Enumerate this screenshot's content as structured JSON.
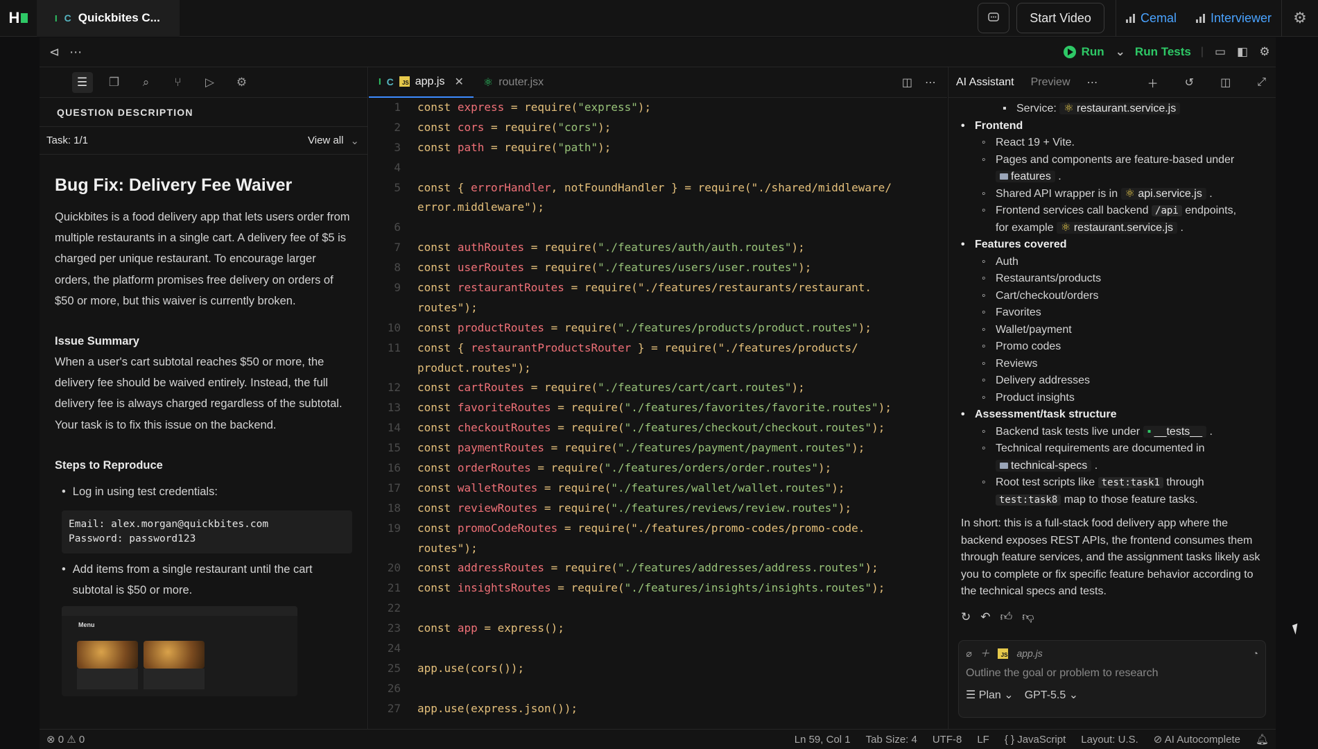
{
  "topbar": {
    "logo": "H",
    "app_tab_title": "Quickbites C...",
    "app_tab_icons": [
      "I",
      "C"
    ],
    "start_video": "Start Video",
    "participants": [
      "Cemal",
      "Interviewer"
    ]
  },
  "toolbar": {
    "run": "Run",
    "run_tests": "Run Tests"
  },
  "left": {
    "section_title": "QUESTION DESCRIPTION",
    "task_label": "Task: 1/1",
    "view_all": "View all",
    "title": "Bug Fix: Delivery Fee Waiver",
    "intro": "Quickbites is a food delivery app that lets users order from multiple restaurants in a single cart. A delivery fee of $5 is charged per unique restaurant. To encourage larger orders, the platform promises free delivery on orders of $50 or more, but this waiver is currently broken.",
    "issue_heading": "Issue Summary",
    "issue_text": "When a user's cart subtotal reaches $50 or more, the delivery fee should be waived entirely. Instead, the full delivery fee is always charged regardless of the subtotal. Your task is to fix this issue on the backend.",
    "steps_heading": "Steps to Reproduce",
    "step1": "Log in using test credentials:",
    "credentials": "Email: alex.morgan@quickbites.com\nPassword: password123",
    "step2": "Add items from a single restaurant until the cart subtotal is $50 or more.",
    "thumb_title": "Menu"
  },
  "editor": {
    "tabs": [
      {
        "label": "app.js",
        "active": true
      },
      {
        "label": "router.jsx",
        "active": false
      }
    ],
    "lines": [
      {
        "n": "1",
        "code": "const express = require(\"express\");"
      },
      {
        "n": "2",
        "code": "const cors = require(\"cors\");"
      },
      {
        "n": "3",
        "code": "const path = require(\"path\");"
      },
      {
        "n": "4",
        "code": ""
      },
      {
        "n": "5",
        "code": "const { errorHandler, notFoundHandler } = require(\"./shared/middleware/"
      },
      {
        "n": "",
        "code": "error.middleware\");"
      },
      {
        "n": "6",
        "code": ""
      },
      {
        "n": "7",
        "code": "const authRoutes = require(\"./features/auth/auth.routes\");"
      },
      {
        "n": "8",
        "code": "const userRoutes = require(\"./features/users/user.routes\");"
      },
      {
        "n": "9",
        "code": "const restaurantRoutes = require(\"./features/restaurants/restaurant."
      },
      {
        "n": "",
        "code": "routes\");"
      },
      {
        "n": "10",
        "code": "const productRoutes = require(\"./features/products/product.routes\");"
      },
      {
        "n": "11",
        "code": "const { restaurantProductsRouter } = require(\"./features/products/"
      },
      {
        "n": "",
        "code": "product.routes\");"
      },
      {
        "n": "12",
        "code": "const cartRoutes = require(\"./features/cart/cart.routes\");"
      },
      {
        "n": "13",
        "code": "const favoriteRoutes = require(\"./features/favorites/favorite.routes\");"
      },
      {
        "n": "14",
        "code": "const checkoutRoutes = require(\"./features/checkout/checkout.routes\");"
      },
      {
        "n": "15",
        "code": "const paymentRoutes = require(\"./features/payment/payment.routes\");"
      },
      {
        "n": "16",
        "code": "const orderRoutes = require(\"./features/orders/order.routes\");"
      },
      {
        "n": "17",
        "code": "const walletRoutes = require(\"./features/wallet/wallet.routes\");"
      },
      {
        "n": "18",
        "code": "const reviewRoutes = require(\"./features/reviews/review.routes\");"
      },
      {
        "n": "19",
        "code": "const promoCodeRoutes = require(\"./features/promo-codes/promo-code."
      },
      {
        "n": "",
        "code": "routes\");"
      },
      {
        "n": "20",
        "code": "const addressRoutes = require(\"./features/addresses/address.routes\");"
      },
      {
        "n": "21",
        "code": "const insightsRoutes = require(\"./features/insights/insights.routes\");"
      },
      {
        "n": "22",
        "code": ""
      },
      {
        "n": "23",
        "code": "const app = express();"
      },
      {
        "n": "24",
        "code": ""
      },
      {
        "n": "25",
        "code": "app.use(cors());"
      },
      {
        "n": "26",
        "code": ""
      },
      {
        "n": "27",
        "code": "app.use(express.json());"
      }
    ]
  },
  "assistant": {
    "tab_active": "AI Assistant",
    "tab_preview": "Preview",
    "service_label": "Service:",
    "service_file": "restaurant.service.js",
    "frontend": "Frontend",
    "fe_items": [
      "React 19 + Vite.",
      "Pages and components are feature-based under",
      "features",
      "Shared API wrapper is in",
      "api.service.js",
      "Frontend services call backend",
      "/api",
      "endpoints,",
      "for example",
      "restaurant.service.js"
    ],
    "features_covered": "Features covered",
    "features": [
      "Auth",
      "Restaurants/products",
      "Cart/checkout/orders",
      "Favorites",
      "Wallet/payment",
      "Promo codes",
      "Reviews",
      "Delivery addresses",
      "Product insights"
    ],
    "assessment": "Assessment/task structure",
    "as_items": {
      "a1": "Backend task tests live under",
      "a1_chip": "__tests__",
      "a2": "Technical requirements are documented in",
      "a2_chip": "technical-specs",
      "a3": "Root test scripts like",
      "a3_chip1": "test:task1",
      "a3_mid": "through",
      "a3_chip2": "test:task8",
      "a3_end": "map to those feature tasks."
    },
    "summary": "In short: this is a full-stack food delivery app where the backend exposes REST APIs, the frontend consumes them through feature services, and the assignment tasks likely ask you to complete or fix specific feature behavior according to the technical specs and tests.",
    "composer_file": "app.js",
    "composer_placeholder": "Outline the goal or problem to research",
    "mode": "Plan",
    "model": "GPT-5.5"
  },
  "status": {
    "errors": "0",
    "warnings": "0",
    "position": "Ln 59, Col 1",
    "tab_size": "Tab Size: 4",
    "encoding": "UTF-8",
    "eol": "LF",
    "language": "JavaScript",
    "layout": "Layout: U.S.",
    "autocomplete": "AI Autocomplete"
  }
}
